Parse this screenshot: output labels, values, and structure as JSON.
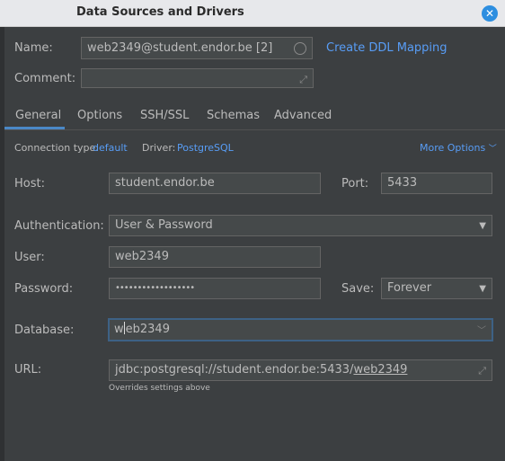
{
  "window": {
    "title": "Data Sources and Drivers",
    "close_icon": "close-icon"
  },
  "name": {
    "label": "Name:",
    "value": "web2349@student.endor.be [2]",
    "link": "Create DDL Mapping"
  },
  "comment": {
    "label": "Comment:",
    "value": ""
  },
  "tabs": [
    {
      "label": "General",
      "active": true
    },
    {
      "label": "Options"
    },
    {
      "label": "SSH/SSL"
    },
    {
      "label": "Schemas"
    },
    {
      "label": "Advanced"
    }
  ],
  "connection": {
    "type_label": "Connection type:",
    "type_value": "default",
    "driver_label": "Driver:",
    "driver_value": "PostgreSQL",
    "more_options": "More Options"
  },
  "host": {
    "label": "Host:",
    "value": "student.endor.be"
  },
  "port": {
    "label": "Port:",
    "value": "5433"
  },
  "authentication": {
    "label": "Authentication:",
    "value": "User & Password"
  },
  "user": {
    "label": "User:",
    "value": "web2349"
  },
  "password": {
    "label": "Password:",
    "value": "••••••••••••••••••"
  },
  "save": {
    "label": "Save:",
    "value": "Forever"
  },
  "database": {
    "label": "Database:",
    "value_before_caret": "w",
    "value_after_caret": "eb2349"
  },
  "url": {
    "label": "URL:",
    "prefix": "jdbc:postgresql://student.endor.be:5433/",
    "db_link": "web2349",
    "hint": "Overrides settings above"
  },
  "colors": {
    "accent": "#589df6",
    "background": "#3c3f41",
    "field": "#45494a",
    "focus_border": "#3d6185"
  }
}
